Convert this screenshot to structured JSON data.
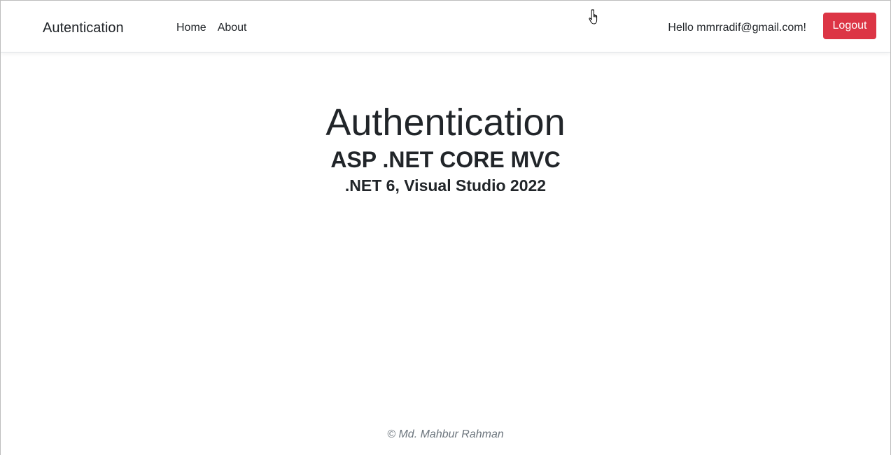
{
  "navbar": {
    "brand": "Autentication",
    "links": [
      {
        "label": "Home"
      },
      {
        "label": "About"
      }
    ],
    "greeting": "Hello mmrradif@gmail.com!",
    "logout_label": "Logout"
  },
  "hero": {
    "title": "Authentication",
    "subtitle": "ASP .NET CORE MVC",
    "subtitle2": ".NET 6, Visual Studio 2022"
  },
  "footer": {
    "text": "© Md. Mahbur Rahman"
  },
  "colors": {
    "logout_bg": "#dc3545",
    "text": "#212529",
    "footer_text": "#6c757d"
  },
  "icons": {
    "cursor": "hand-pointer-icon"
  }
}
